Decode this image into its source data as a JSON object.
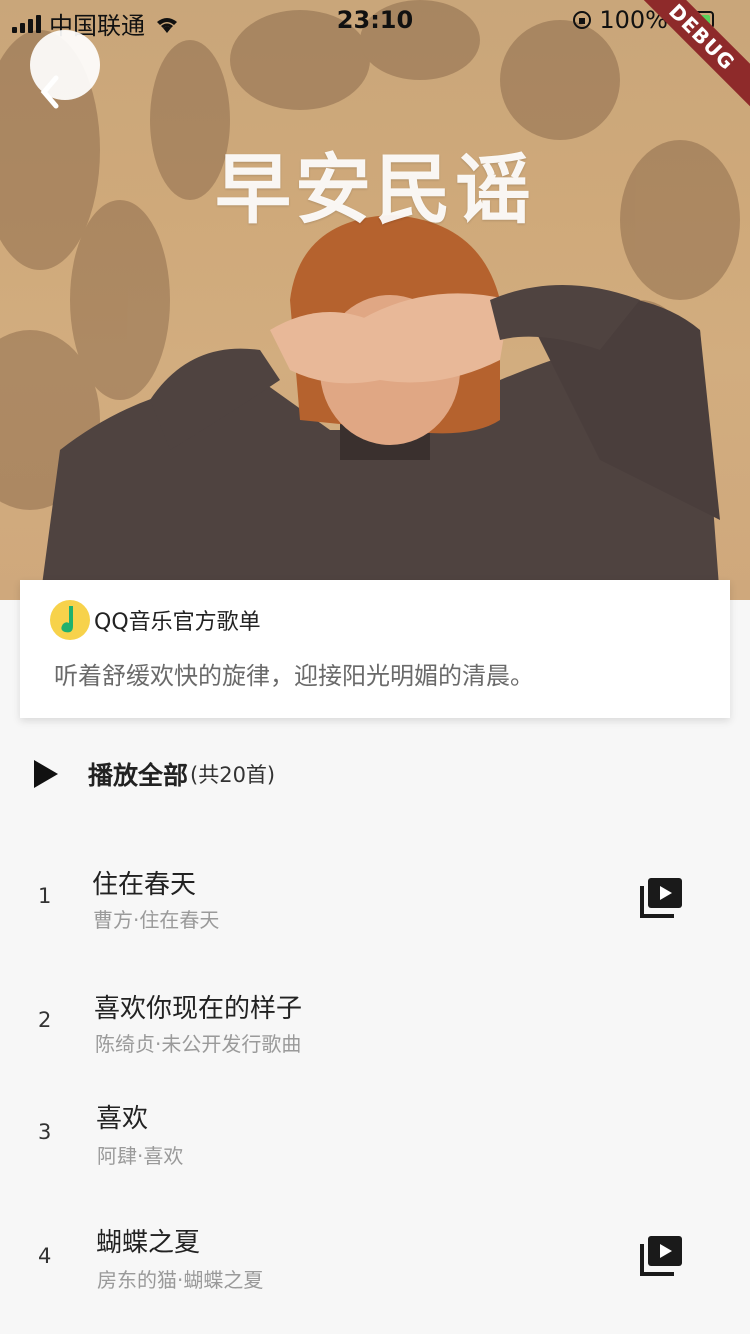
{
  "status": {
    "carrier": "中国联通",
    "time": "23:10",
    "battery": "100%"
  },
  "debug_label": "DEBUG",
  "hero": {
    "title": "早安民谣"
  },
  "card": {
    "source": "QQ音乐官方歌单",
    "description": "听着舒缓欢快的旋律，迎接阳光明媚的清晨。"
  },
  "play_all": {
    "label": "播放全部",
    "count": "(共20首)"
  },
  "tracks": [
    {
      "num": "1",
      "title": "住在春天",
      "sub": "曹方·住在春天",
      "has_mv": true
    },
    {
      "num": "2",
      "title": "喜欢你现在的样子",
      "sub": "陈绮贞·未公开发行歌曲",
      "has_mv": false
    },
    {
      "num": "3",
      "title": "喜欢",
      "sub": "阿肆·喜欢",
      "has_mv": false
    },
    {
      "num": "4",
      "title": "蝴蝶之夏",
      "sub": "房东的猫·蝴蝶之夏",
      "has_mv": true
    }
  ],
  "icons": {
    "back": "back-arrow-icon",
    "logo": "app-logo-icon",
    "qq": "qq-music-icon",
    "mv": "video-library-icon",
    "play": "play-icon",
    "wifi": "wifi-icon",
    "signal": "signal-icon",
    "battery": "battery-icon",
    "lock": "rotation-lock-icon"
  },
  "colors": {
    "debug_ribbon": "#8e2a2a",
    "battery_fill": "#58d15a",
    "qq_yellow": "#f7d24b"
  }
}
